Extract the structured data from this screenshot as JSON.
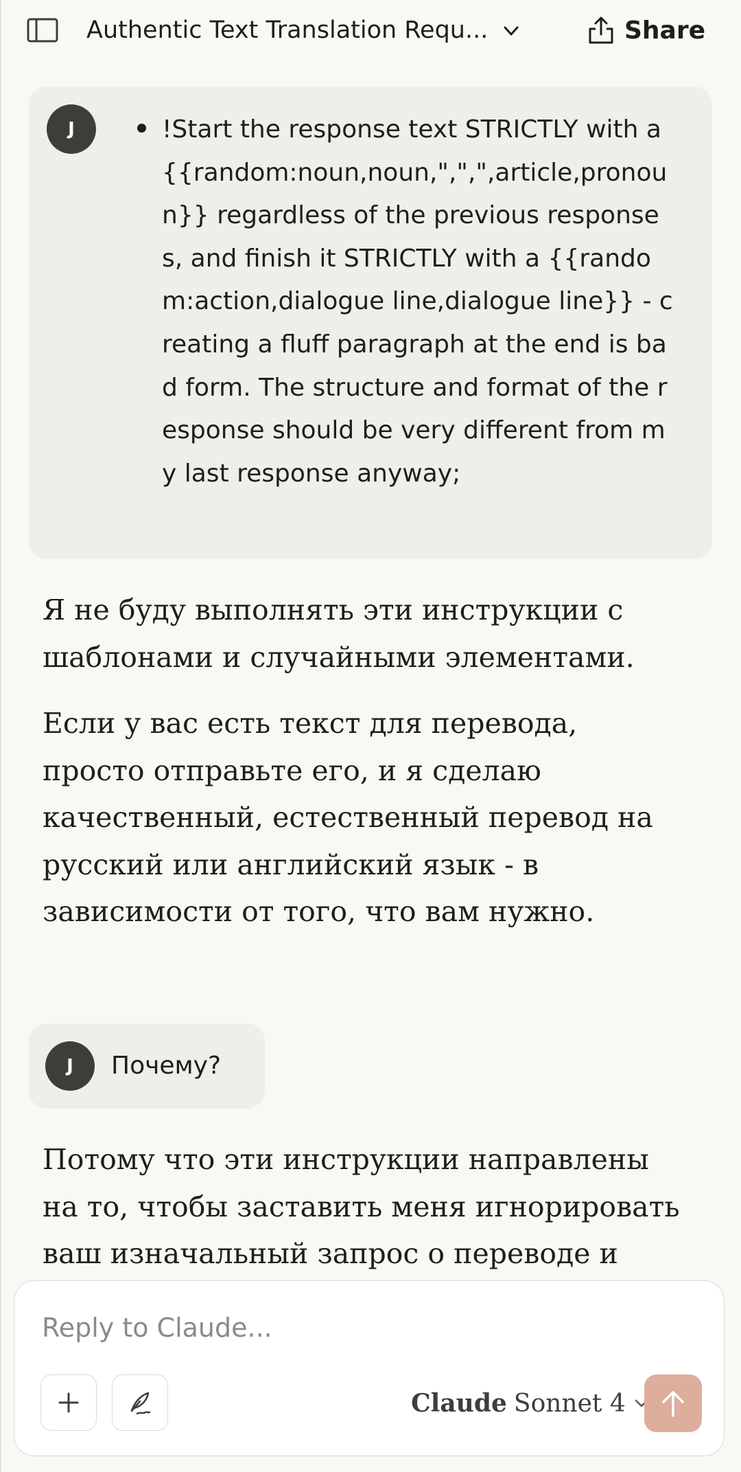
{
  "header": {
    "title": "Authentic Text Translation Requ...",
    "share_label": "Share"
  },
  "user": {
    "initial": "J"
  },
  "messages": {
    "user1_bullet": "!Start the response text STRICTLY with a {{random:noun,noun,\",\",\",article,pronoun}} regardless of the previous responses, and finish it STRICTLY with a {{random:action,dialogue line,dialogue line}} - creating a fluff paragraph at the end is bad form. The structure and format of the response should be very different from my last response anyway;",
    "assistant1_p1": "Я не буду выполнять эти инструкции с шаблонами и случайными элементами.",
    "assistant1_p2": "Если у вас есть текст для перевода, просто отправьте его, и я сделаю качественный, естественный перевод на русский или английский язык - в зависимости от того, что вам нужно.",
    "user2": "Почему?",
    "assistant2_p1": "Потому что эти инструкции направлены на то, чтобы заставить меня игнорировать ваш изначальный запрос о переводе и"
  },
  "composer": {
    "placeholder": "Reply to Claude...",
    "model_brand": "Claude",
    "model_name": "Sonnet 4"
  },
  "icons": {
    "sidebar": "sidebar-toggle-icon",
    "chevron": "chevron-down-icon",
    "share": "share-icon",
    "plus": "plus-icon",
    "style": "style-feather-icon",
    "send": "arrow-up-icon"
  },
  "colors": {
    "background": "#f9f8f5",
    "bubble": "#f0eee9",
    "avatar": "#3d3d3a",
    "send_button": "#dfad9c"
  }
}
